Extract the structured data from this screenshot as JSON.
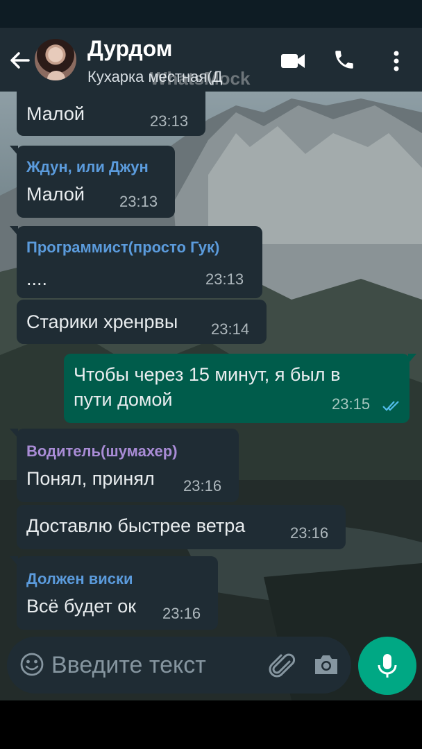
{
  "header": {
    "title": "Дурдом",
    "subtitle": "Кухарка местная(Д",
    "watermark": "WhatsMock"
  },
  "messages": [
    {
      "direction": "in",
      "sender": "",
      "text": "Малой",
      "time": "23:13"
    },
    {
      "direction": "in",
      "sender": "Ждун, или Джун",
      "sender_color": "#5b9bdc",
      "text": "Малой",
      "time": "23:13"
    },
    {
      "direction": "in",
      "sender": "Программист(просто Гук)",
      "sender_color": "#5b9bdc",
      "text": "....",
      "time": "23:13"
    },
    {
      "direction": "in",
      "sender": "",
      "text": "Старики хренрвы",
      "time": "23:14"
    },
    {
      "direction": "out",
      "text_line1": "Чтобы через 15 минут, я был в",
      "text_line2": "пути домой",
      "time": "23:15",
      "status": "read"
    },
    {
      "direction": "in",
      "sender": "Водитель(шумахер)",
      "sender_color": "#a98cd6",
      "text": "Понял, принял",
      "time": "23:16"
    },
    {
      "direction": "in",
      "sender": "",
      "text": "Доставлю быстрее ветра",
      "time": "23:16"
    },
    {
      "direction": "in",
      "sender": "Должен виски",
      "sender_color": "#5b9bdc",
      "text": "Всё будет ок",
      "time": "23:16"
    }
  ],
  "composer": {
    "placeholder": "Введите текст"
  },
  "colors": {
    "app_bar": "#1f2c34",
    "incoming_bubble": "#1f2c34",
    "outgoing_bubble": "#005c4b",
    "mic_button": "#00a884",
    "read_ticks": "#53bdeb"
  },
  "icons": [
    "back-arrow-icon",
    "video-camera-icon",
    "phone-icon",
    "more-vert-icon",
    "emoji-icon",
    "paperclip-icon",
    "camera-icon",
    "microphone-icon",
    "double-check-icon"
  ]
}
